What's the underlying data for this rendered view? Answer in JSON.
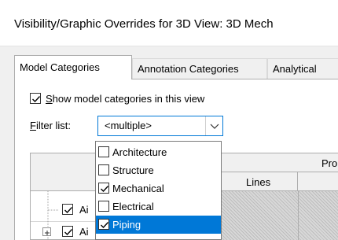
{
  "window": {
    "title": "Visibility/Graphic Overrides for 3D View: 3D Mech"
  },
  "tabs": [
    {
      "label": "Model Categories",
      "active": true
    },
    {
      "label": "Annotation Categories",
      "active": false
    },
    {
      "label": "Analytical",
      "active": false
    }
  ],
  "show_categories": {
    "checked": true,
    "label_prefix": "S",
    "label_rest": "how model categories in this view"
  },
  "filter": {
    "label_prefix": "F",
    "label_rest": "ilter list:",
    "value": "<multiple>"
  },
  "dropdown_options": [
    {
      "label": "Architecture",
      "checked": false,
      "selected": false
    },
    {
      "label": "Structure",
      "checked": false,
      "selected": false
    },
    {
      "label": "Mechanical",
      "checked": true,
      "selected": false
    },
    {
      "label": "Electrical",
      "checked": false,
      "selected": false
    },
    {
      "label": "Piping",
      "checked": true,
      "selected": true
    }
  ],
  "grid": {
    "header_group": "Pro",
    "header_lines": "Lines",
    "rows": [
      {
        "label": "Ai",
        "checked": true
      },
      {
        "label": "Ai",
        "checked": true
      }
    ]
  },
  "colors": {
    "accent": "#0078d7",
    "dialog_bg": "#f0f0f0",
    "border": "#adadad"
  }
}
